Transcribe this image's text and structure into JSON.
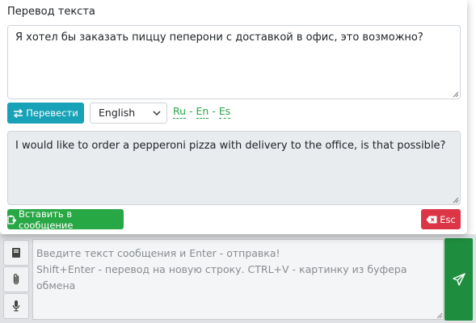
{
  "dialog": {
    "title": "Перевод текста",
    "source_text": "Я хотел бы заказать пиццу пеперони с доставкой в офис, это возможно?",
    "translate_button": "Перевести",
    "target_language": "English",
    "language_pairs": [
      "Ru",
      "En",
      "Es"
    ],
    "language_separator": " - ",
    "result_text": "I would like to order a pepperoni pizza with delivery to the office, is that possible?",
    "insert_button": "Вставить в сообщение",
    "esc_button": "Esc"
  },
  "composer": {
    "placeholder": "Введите текст сообщения и Enter - отправка!\nShift+Enter - перевод на новую строку. CTRL+V - картинку из буфера обмена"
  },
  "icons": {
    "translate": "exchange-arrows-icon",
    "dropdown": "chevron-down-icon",
    "insert": "paste-icon",
    "esc": "backspace-icon",
    "book": "book-icon",
    "attach": "paperclip-icon",
    "mic": "microphone-icon",
    "send": "paper-plane-icon"
  },
  "colors": {
    "info": "#17a2b8",
    "success": "#28a745",
    "danger": "#dc3545",
    "send": "#1e8e3e"
  }
}
